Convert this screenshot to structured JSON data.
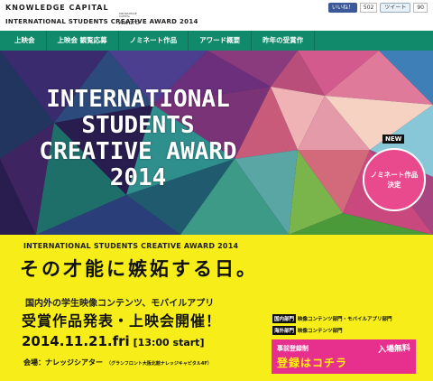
{
  "header": {
    "brand": "KNOWLEDGE CAPITAL",
    "sub_title": "INTERNATIONAL STUDENTS CREATIVE AWARD 2014",
    "award_logo_small": "KNOWLEDGE CAPITAL",
    "award_logo_word": "Award",
    "facebook_label": "いいね！",
    "facebook_count": "502",
    "tweet_label": "ツイート",
    "tweet_count": "90"
  },
  "nav": {
    "items": [
      {
        "label": "上映会"
      },
      {
        "label": "上映会 観覧応募"
      },
      {
        "label": "ノミネート作品"
      },
      {
        "label": "アワード概要"
      },
      {
        "label": "昨年の受賞作"
      }
    ]
  },
  "hero": {
    "title_lines": [
      "INTERNATIONAL",
      "STUDENTS",
      "CREATIVE AWARD",
      "2014"
    ],
    "new_badge": "NEW",
    "nominee_line1": "ノミネート作品",
    "nominee_line2": "決定"
  },
  "event": {
    "heading": "INTERNATIONAL STUDENTS CREATIVE AWARD 2014",
    "catchcopy": "その才能に嫉妬する日。",
    "line1": "国内外の学生映像コンテンツ、モバイルアプリ",
    "line2": "受賞作品発表・上映会開催！",
    "categories": [
      {
        "tag": "国内部門",
        "text": "映像コンテンツ部門・モバイルアプリ部門"
      },
      {
        "tag": "海外部門",
        "text": "映像コンテンツ部門"
      }
    ],
    "date": "2014.11.21.fri",
    "time": "[13:00 start]",
    "venue": "会場：ナレッジシアター",
    "venue_detail": "（グランフロント大阪北館ナレッジキャピタル4F）",
    "register_pre": "事前登録制",
    "register_main": "登録はコチラ",
    "admission": "入場無料"
  },
  "colors": {
    "nav_bg": "#108a6a",
    "yellow": "#f7ee19",
    "pink": "#e84a8d"
  }
}
